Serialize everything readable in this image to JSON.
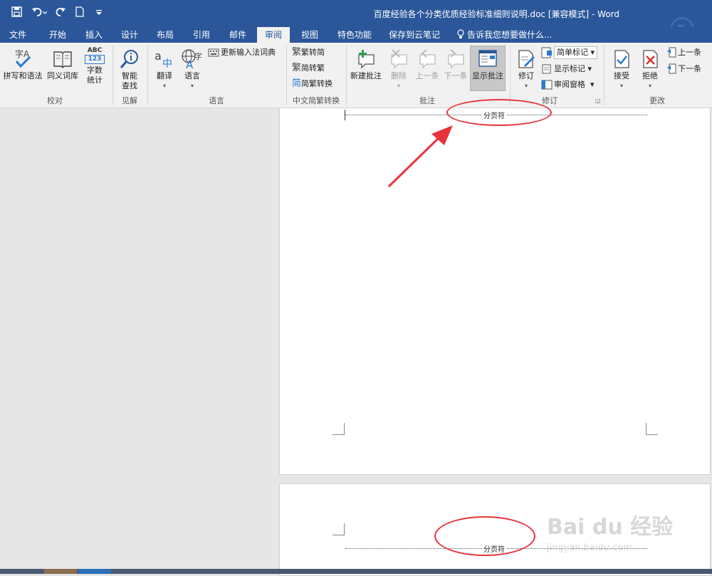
{
  "window": {
    "title": "百度经验各个分类优质经验标准细则说明.doc [兼容模式] - Word"
  },
  "tabs": [
    {
      "label": "文件"
    },
    {
      "label": "开始"
    },
    {
      "label": "插入"
    },
    {
      "label": "设计"
    },
    {
      "label": "布局"
    },
    {
      "label": "引用"
    },
    {
      "label": "邮件"
    },
    {
      "label": "审阅",
      "active": true
    },
    {
      "label": "视图"
    },
    {
      "label": "特色功能"
    },
    {
      "label": "保存到云笔记"
    }
  ],
  "tellme": "告诉我您想要做什么...",
  "ribbon": {
    "proofing": {
      "label": "校对",
      "spelling": "拼写和语法",
      "thesaurus": "同义词库",
      "wordcount_l1": "字数",
      "wordcount_l2": "统计",
      "abc": "ABC",
      "n123": "123"
    },
    "insights": {
      "label": "见解",
      "smart_l1": "智能",
      "smart_l2": "查找"
    },
    "language": {
      "label": "语言",
      "translate": "翻译",
      "language": "语言",
      "update_ime": "更新输入法词典"
    },
    "chinese": {
      "label": "中文简繁转换",
      "to_simplified": "繁转简",
      "to_traditional": "简转繁",
      "convert": "简繁转换"
    },
    "comments": {
      "label": "批注",
      "new": "新建批注",
      "delete": "删除",
      "prev": "上一条",
      "next": "下一条",
      "show": "显示批注"
    },
    "tracking": {
      "label": "修订",
      "track": "修订",
      "markup": "简单标记",
      "show_markup": "显示标记",
      "pane": "审阅窗格"
    },
    "changes": {
      "label": "更改",
      "accept": "接受",
      "reject": "拒绝",
      "prev": "上一条",
      "next": "下一条"
    }
  },
  "document": {
    "page_break_label": "分页符"
  },
  "watermark": {
    "brand": "Bai du 经验",
    "url": "jingyan.baidu.com"
  },
  "colors": {
    "accent": "#2b579a",
    "annotation": "#e8333a"
  }
}
